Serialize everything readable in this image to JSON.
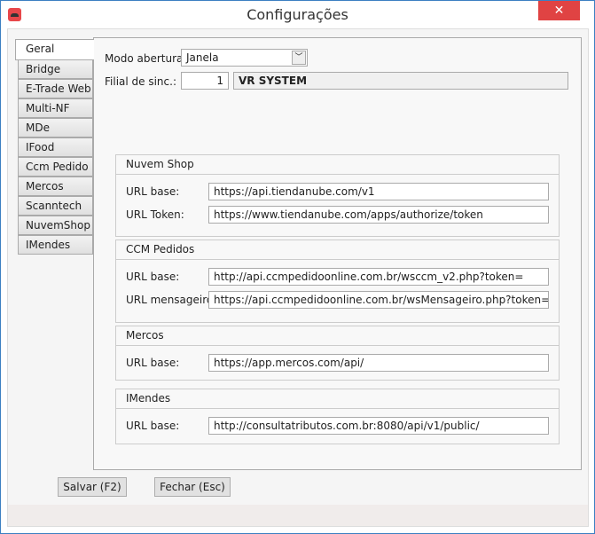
{
  "window": {
    "title": "Configurações",
    "close": "✕"
  },
  "tabs": [
    "Geral",
    "Bridge",
    "E-Trade Web",
    "Multi-NF",
    "MDe",
    "IFood",
    "Ccm Pedido",
    "Mercos",
    "Scanntech",
    "NuvemShop",
    "IMendes"
  ],
  "geral": {
    "modo_label": "Modo abertura:",
    "modo_value": "Janela",
    "filial_label": "Filial de sinc.:",
    "filial_value": "1",
    "filial_name": "VR SYSTEM"
  },
  "groups": [
    {
      "title": "Nuvem Shop",
      "fields": [
        {
          "label": "URL base:",
          "value": "https://api.tiendanube.com/v1"
        },
        {
          "label": "URL Token:",
          "value": "https://www.tiendanube.com/apps/authorize/token"
        }
      ]
    },
    {
      "title": "CCM Pedidos",
      "fields": [
        {
          "label": "URL base:",
          "value": "http://api.ccmpedidoonline.com.br/wsccm_v2.php?token="
        },
        {
          "label": "URL mensageiro:",
          "value": "https://api.ccmpedidoonline.com.br/wsMensageiro.php?token="
        }
      ]
    },
    {
      "title": "Mercos",
      "fields": [
        {
          "label": "URL base:",
          "value": "https://app.mercos.com/api/"
        }
      ]
    },
    {
      "title": "IMendes",
      "fields": [
        {
          "label": "URL base:",
          "value": "http://consultatributos.com.br:8080/api/v1/public/"
        }
      ]
    }
  ],
  "buttons": {
    "save": "Salvar (F2)",
    "close": "Fechar (Esc)"
  }
}
